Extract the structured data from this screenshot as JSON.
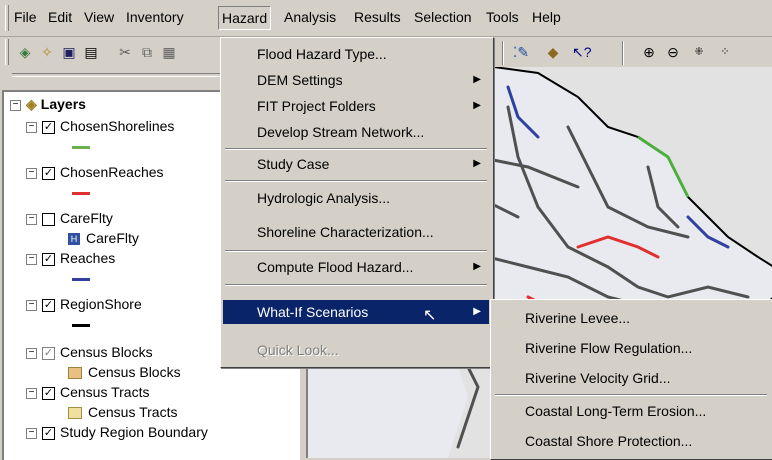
{
  "menubar": {
    "items": [
      "File",
      "Edit",
      "View",
      "Inventory",
      "Hazard",
      "Analysis",
      "Results",
      "Selection",
      "Tools",
      "Help"
    ]
  },
  "toc": {
    "root": "Layers",
    "layers": [
      {
        "name": "ChosenShorelines",
        "checked": true,
        "swatch": "#6ab04c"
      },
      {
        "name": "ChosenReaches",
        "checked": true,
        "swatch": "#e03030"
      },
      {
        "name": "CareFlty",
        "checked": false,
        "child": "CareFlty"
      },
      {
        "name": "Reaches",
        "checked": true,
        "swatch": "#3040a0"
      },
      {
        "name": "RegionShore",
        "checked": true,
        "swatch": "#000000"
      },
      {
        "name": "Census Blocks",
        "checked": true,
        "grey": true,
        "child": "Census Blocks"
      },
      {
        "name": "Census Tracts",
        "checked": true,
        "child": "Census Tracts"
      },
      {
        "name": "Study Region Boundary",
        "checked": true
      }
    ]
  },
  "hazard_menu": {
    "items": [
      {
        "label": "Flood Hazard Type...",
        "submenu": false
      },
      {
        "label": "DEM Settings",
        "submenu": true
      },
      {
        "label": "FIT Project Folders",
        "submenu": true
      },
      {
        "label": "Develop Stream Network...",
        "submenu": false
      },
      {
        "label": "Study Case",
        "submenu": true
      },
      {
        "label": "Hydrologic Analysis...",
        "submenu": false
      },
      {
        "label": "Shoreline Characterization...",
        "submenu": false
      },
      {
        "label": "Compute Flood Hazard...",
        "submenu": true
      },
      {
        "label": "What-If Scenarios",
        "submenu": true,
        "highlighted": true
      },
      {
        "label": "Quick Look...",
        "submenu": false,
        "disabled": true
      }
    ]
  },
  "whatif_submenu": {
    "items": [
      "Riverine Levee...",
      "Riverine Flow Regulation...",
      "Riverine Velocity Grid...",
      "Coastal Long-Term Erosion...",
      "Coastal Shore Protection..."
    ]
  },
  "colors": {
    "menu_highlight": "#0a246a",
    "shoreline": "#6ab04c",
    "reach": "#e03030",
    "stream": "#3040a0"
  }
}
